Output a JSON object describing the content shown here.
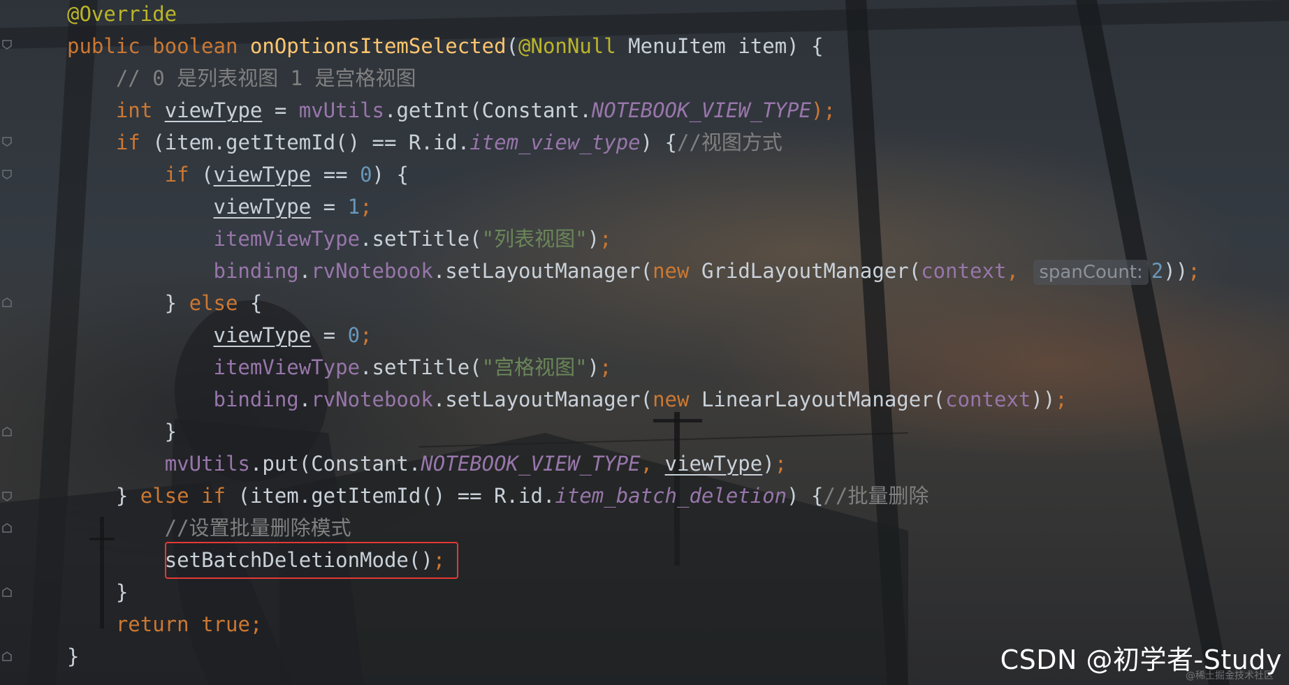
{
  "editor": {
    "lines": [
      [
        {
          "t": "@Override",
          "c": "ann"
        }
      ],
      [
        {
          "t": "public ",
          "c": "kw"
        },
        {
          "t": "boolean ",
          "c": "kw"
        },
        {
          "t": "onOptionsItemSelected",
          "c": "fn"
        },
        {
          "t": "(",
          "c": "plain"
        },
        {
          "t": "@NonNull",
          "c": "ann"
        },
        {
          "t": " MenuItem item) {",
          "c": "plain"
        }
      ],
      [
        {
          "t": "    // 0 是列表视图 1 是宫格视图",
          "c": "cmt"
        }
      ],
      [
        {
          "t": "    ",
          "c": "plain"
        },
        {
          "t": "int ",
          "c": "kw"
        },
        {
          "t": "viewType",
          "c": "var"
        },
        {
          "t": " = ",
          "c": "plain"
        },
        {
          "t": "mvUtils",
          "c": "field"
        },
        {
          "t": ".getInt(Constant.",
          "c": "plain"
        },
        {
          "t": "NOTEBOOK_VIEW_TYPE",
          "c": "const"
        },
        {
          "t": ");",
          "c": "kw"
        }
      ],
      [
        {
          "t": "    ",
          "c": "plain"
        },
        {
          "t": "if ",
          "c": "kw"
        },
        {
          "t": "(item.getItemId() == R.id.",
          "c": "plain"
        },
        {
          "t": "item_view_type",
          "c": "const"
        },
        {
          "t": ") {",
          "c": "plain"
        },
        {
          "t": "//视图方式",
          "c": "cmt"
        }
      ],
      [
        {
          "t": "        ",
          "c": "plain"
        },
        {
          "t": "if ",
          "c": "kw"
        },
        {
          "t": "(",
          "c": "plain"
        },
        {
          "t": "viewType",
          "c": "var"
        },
        {
          "t": " == ",
          "c": "plain"
        },
        {
          "t": "0",
          "c": "num"
        },
        {
          "t": ") {",
          "c": "plain"
        }
      ],
      [
        {
          "t": "            ",
          "c": "plain"
        },
        {
          "t": "viewType",
          "c": "var"
        },
        {
          "t": " = ",
          "c": "plain"
        },
        {
          "t": "1",
          "c": "num"
        },
        {
          "t": ";",
          "c": "kw"
        }
      ],
      [
        {
          "t": "            ",
          "c": "plain"
        },
        {
          "t": "itemViewType",
          "c": "field"
        },
        {
          "t": ".setTitle(",
          "c": "plain"
        },
        {
          "t": "\"列表视图\"",
          "c": "str"
        },
        {
          "t": ")",
          "c": "plain"
        },
        {
          "t": ";",
          "c": "kw"
        }
      ],
      [
        {
          "t": "            ",
          "c": "plain"
        },
        {
          "t": "binding",
          "c": "field"
        },
        {
          "t": ".",
          "c": "plain"
        },
        {
          "t": "rvNotebook",
          "c": "field"
        },
        {
          "t": ".setLayoutManager(",
          "c": "plain"
        },
        {
          "t": "new ",
          "c": "kw"
        },
        {
          "t": "GridLayoutManager(",
          "c": "plain"
        },
        {
          "t": "context",
          "c": "field"
        },
        {
          "t": ", ",
          "c": "kw"
        },
        {
          "t": "spanCount:",
          "c": "hint"
        },
        {
          "t": "2",
          "c": "num"
        },
        {
          "t": "))",
          "c": "plain"
        },
        {
          "t": ";",
          "c": "kw"
        }
      ],
      [
        {
          "t": "        } ",
          "c": "plain"
        },
        {
          "t": "else ",
          "c": "kw"
        },
        {
          "t": "{",
          "c": "plain"
        }
      ],
      [
        {
          "t": "            ",
          "c": "plain"
        },
        {
          "t": "viewType",
          "c": "var"
        },
        {
          "t": " = ",
          "c": "plain"
        },
        {
          "t": "0",
          "c": "num"
        },
        {
          "t": ";",
          "c": "kw"
        }
      ],
      [
        {
          "t": "            ",
          "c": "plain"
        },
        {
          "t": "itemViewType",
          "c": "field"
        },
        {
          "t": ".setTitle(",
          "c": "plain"
        },
        {
          "t": "\"宫格视图\"",
          "c": "str"
        },
        {
          "t": ")",
          "c": "plain"
        },
        {
          "t": ";",
          "c": "kw"
        }
      ],
      [
        {
          "t": "            ",
          "c": "plain"
        },
        {
          "t": "binding",
          "c": "field"
        },
        {
          "t": ".",
          "c": "plain"
        },
        {
          "t": "rvNotebook",
          "c": "field"
        },
        {
          "t": ".setLayoutManager(",
          "c": "plain"
        },
        {
          "t": "new ",
          "c": "kw"
        },
        {
          "t": "LinearLayoutManager(",
          "c": "plain"
        },
        {
          "t": "context",
          "c": "field"
        },
        {
          "t": "))",
          "c": "plain"
        },
        {
          "t": ";",
          "c": "kw"
        }
      ],
      [
        {
          "t": "        }",
          "c": "plain"
        }
      ],
      [
        {
          "t": "        ",
          "c": "plain"
        },
        {
          "t": "mvUtils",
          "c": "field"
        },
        {
          "t": ".put(Constant.",
          "c": "plain"
        },
        {
          "t": "NOTEBOOK_VIEW_TYPE",
          "c": "const"
        },
        {
          "t": ", ",
          "c": "kw"
        },
        {
          "t": "viewType",
          "c": "var"
        },
        {
          "t": ")",
          "c": "plain"
        },
        {
          "t": ";",
          "c": "kw"
        }
      ],
      [
        {
          "t": "    } ",
          "c": "plain"
        },
        {
          "t": "else if ",
          "c": "kw"
        },
        {
          "t": "(item.getItemId() == R.id.",
          "c": "plain"
        },
        {
          "t": "item_batch_deletion",
          "c": "const"
        },
        {
          "t": ") {",
          "c": "plain"
        },
        {
          "t": "//批量删除",
          "c": "cmt"
        }
      ],
      [
        {
          "t": "        //设置批量删除模式",
          "c": "cmt"
        }
      ],
      [
        {
          "t": "        ",
          "c": "plain"
        },
        {
          "t": "setBatchDeletionMode()",
          "c": "plain"
        },
        {
          "t": ";",
          "c": "kw"
        }
      ],
      [
        {
          "t": "    }",
          "c": "plain"
        }
      ],
      [
        {
          "t": "    ",
          "c": "plain"
        },
        {
          "t": "return ",
          "c": "kw"
        },
        {
          "t": "true",
          "c": "kw"
        },
        {
          "t": ";",
          "c": "kw"
        }
      ],
      [
        {
          "t": "}",
          "c": "plain"
        }
      ]
    ]
  },
  "colors": {
    "keyword": "#cc7832",
    "annotation": "#bbb529",
    "method": "#ffc66d",
    "field": "#9876aa",
    "number": "#6897bb",
    "string": "#6a8759",
    "comment": "#808080",
    "highlight_border": "#e53935"
  },
  "watermark": {
    "text": "CSDN @初学者-Study",
    "sub": "@稀土掘金技术社区"
  }
}
